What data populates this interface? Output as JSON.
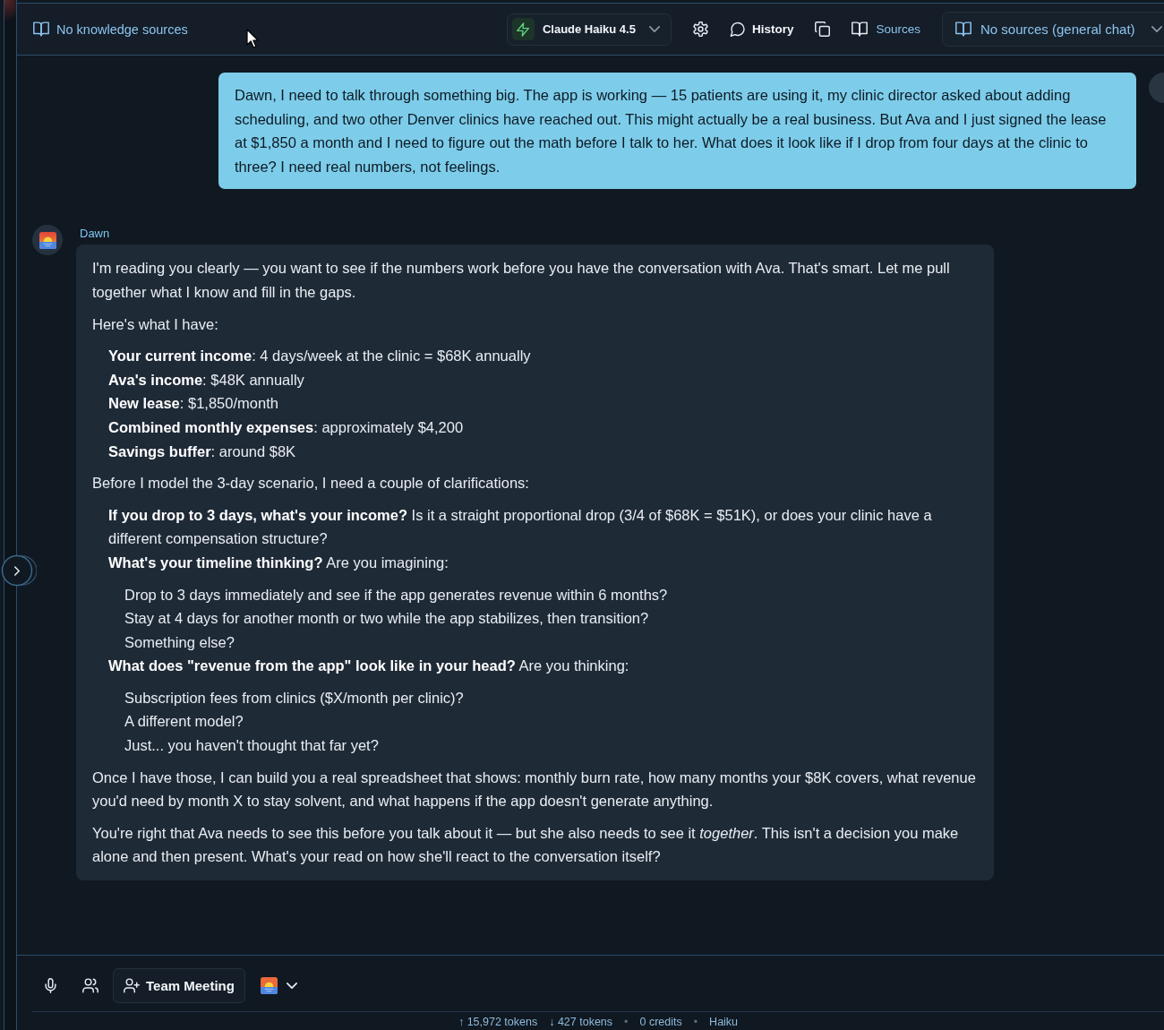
{
  "top_bar": {
    "knowledge_sources": "No knowledge sources",
    "model_selector": {
      "label": "Claude Haiku 4.5"
    },
    "history_button": "History",
    "sources_button": "Sources",
    "sources_dropdown": {
      "value": "No sources (general chat)"
    }
  },
  "messages": [
    {
      "kind": "user",
      "text": "Dawn, I need to talk through something big. The app is working — 15 patients are using it, my clinic director asked about adding scheduling, and two other Denver clinics have reached out. This might actually be a real business. But Ava and I just signed the lease at $1,850 a month and I need to figure out the math before I talk to her. What does it look like if I drop from four days at the clinic to three? I need real numbers, not feelings."
    },
    {
      "kind": "assistant",
      "sender": "Dawn",
      "blocks": [
        {
          "kind": "paragraph",
          "text": "I'm reading you clearly — you want to see if the numbers work before you have the conversation with Ava. That's smart. Let me pull together what I know and fill in the gaps."
        },
        {
          "kind": "paragraph",
          "text": "Here's what I have:"
        },
        {
          "kind": "list",
          "items": [
            {
              "text": "**Your current income**: 4 days/week at the clinic = $68K annually"
            },
            {
              "text": "**Ava's income**: $48K annually"
            },
            {
              "text": "**New lease**: $1,850/month"
            },
            {
              "text": "**Combined monthly expenses**: approximately $4,200"
            },
            {
              "text": "**Savings buffer**: around $8K"
            }
          ]
        },
        {
          "kind": "paragraph",
          "text": "Before I model the 3-day scenario, I need a couple of clarifications:"
        },
        {
          "kind": "list",
          "items": [
            {
              "text": "**If you drop to 3 days, what's your income?** Is it a straight proportional drop (3/4 of $68K = $51K), or does your clinic have a different compensation structure?"
            },
            {
              "text": "**What's your timeline thinking?** Are you imagining:",
              "children": [
                {
                  "text": "Drop to 3 days immediately and see if the app generates revenue within 6 months?"
                },
                {
                  "text": "Stay at 4 days for another month or two while the app stabilizes, then transition?"
                },
                {
                  "text": "Something else?"
                }
              ]
            },
            {
              "text": "**What does \"revenue from the app\" look like in your head?** Are you thinking:",
              "children": [
                {
                  "text": "Subscription fees from clinics ($X/month per clinic)?"
                },
                {
                  "text": "A different model?"
                },
                {
                  "text": "Just... you haven't thought that far yet?"
                }
              ]
            }
          ]
        },
        {
          "kind": "paragraph",
          "text": "Once I have those, I can build you a real spreadsheet that shows: monthly burn rate, how many months your $8K covers, what revenue you'd need by month X to stay solvent, and what happens if the app doesn't generate anything."
        },
        {
          "kind": "paragraph",
          "text": "You're right that Ava needs to see this before you talk about it — but she also needs to see it *together*. This isn't a decision you make alone and then present. What's your read on how she'll react to the conversation itself?"
        }
      ]
    }
  ],
  "composer": {
    "team_meeting_button": "Team Meeting"
  },
  "status_bar": {
    "items": [
      {
        "kind": "stat",
        "text": "↑ 15,972 tokens"
      },
      {
        "kind": "stat",
        "text": "↓ 427 tokens"
      },
      {
        "kind": "separator",
        "text": "•"
      },
      {
        "kind": "stat",
        "text": "0 credits"
      },
      {
        "kind": "separator",
        "text": "•"
      },
      {
        "kind": "stat",
        "text": "Haiku"
      }
    ]
  }
}
